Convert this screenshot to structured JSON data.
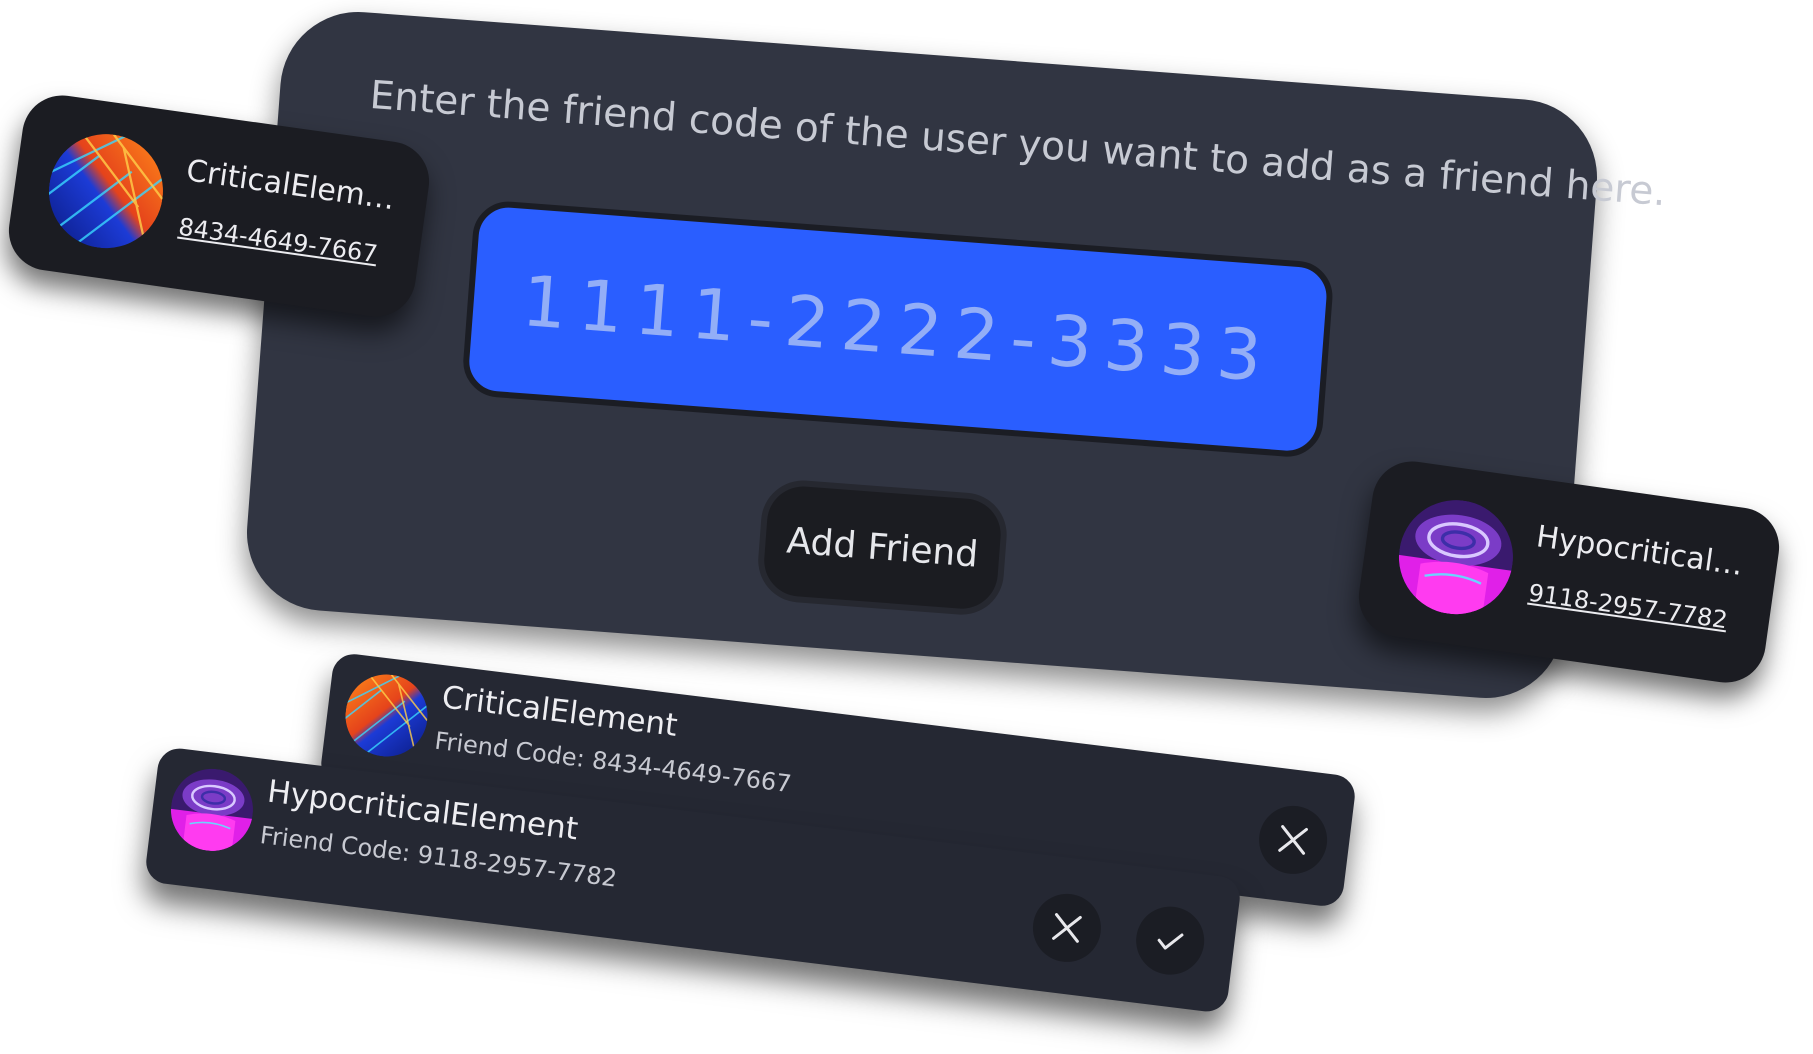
{
  "dialog": {
    "instruction": "Enter the friend code of the user you want to add as a friend here.",
    "code_placeholder": "1111-2222-3333",
    "add_button_label": "Add Friend"
  },
  "profile_cards": [
    {
      "name": "CriticalElement",
      "code": "8434-4649-7667",
      "avatar_icon": "fiery-blue-abstract-avatar"
    },
    {
      "name": "HypocriticalEle...",
      "code": "9118-2957-7782",
      "avatar_icon": "purple-swirl-abstract-avatar"
    }
  ],
  "requests": [
    {
      "name": "CriticalElement",
      "code_label": "Friend Code: 8434-4649-7667",
      "actions": [
        "close-icon"
      ]
    },
    {
      "name": "HypocriticalElement",
      "code_label": "Friend Code: 9118-2957-7782",
      "actions": [
        "close-icon",
        "check-icon"
      ]
    }
  ],
  "colors": {
    "panel": "#313542",
    "input_fill": "#2a5eff",
    "card": "#1b1c22",
    "request_row": "#252833"
  }
}
